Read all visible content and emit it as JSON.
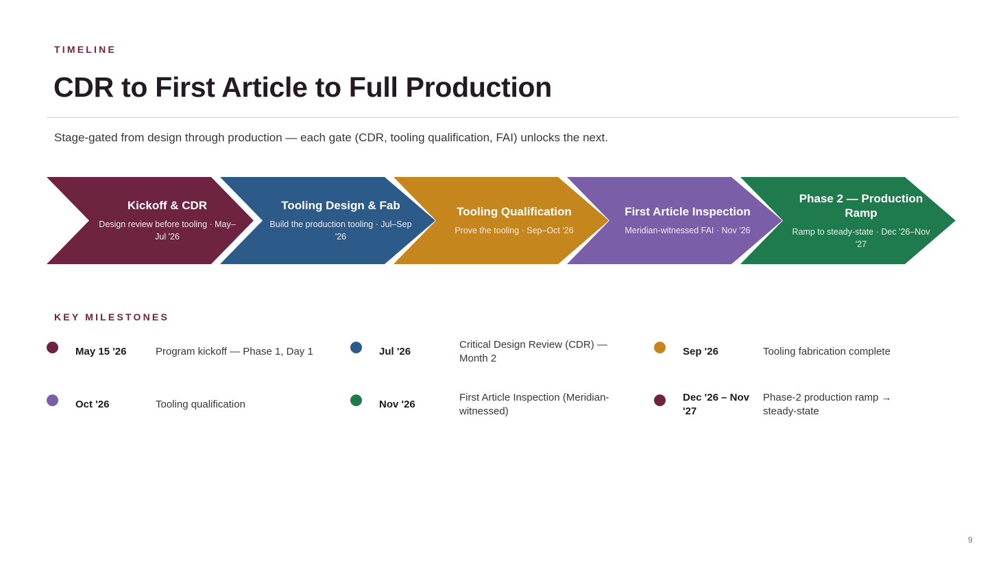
{
  "eyebrow": "TIMELINE",
  "title": "CDR to First Article to Full Production",
  "subtitle": "Stage-gated from design through production — each gate (CDR, tooling qualification, FAI) unlocks the next.",
  "phases": [
    {
      "name": "Kickoff & CDR",
      "desc": "Design review before tooling · May–Jul '26",
      "color": "#6e2440"
    },
    {
      "name": "Tooling Design & Fab",
      "desc": "Build the production tooling · Jul–Sep '26",
      "color": "#2c5b8a"
    },
    {
      "name": "Tooling Qualification",
      "desc": "Prove the tooling · Sep–Oct '26",
      "color": "#c5861d"
    },
    {
      "name": "First Article Inspection",
      "desc": "Meridian-witnessed FAI · Nov '26",
      "color": "#7b5ea8"
    },
    {
      "name": "Phase 2 — Production Ramp",
      "desc": "Ramp to steady-state · Dec '26–Nov '27",
      "color": "#1f7a4d"
    }
  ],
  "milestones_title": "KEY MILESTONES",
  "milestones": [
    {
      "date": "May 15 '26",
      "text": "Program kickoff — Phase 1, Day 1",
      "color": "#6e2440"
    },
    {
      "date": "Jul '26",
      "text": "Critical Design Review (CDR) — Month 2",
      "color": "#2c5b8a"
    },
    {
      "date": "Sep '26",
      "text": "Tooling fabrication complete",
      "color": "#c5861d"
    },
    {
      "date": "Oct '26",
      "text": "Tooling qualification",
      "color": "#7b5ea8"
    },
    {
      "date": "Nov '26",
      "text": "First Article Inspection (Meridian-witnessed)",
      "color": "#1f7a4d"
    },
    {
      "date": "Dec '26 – Nov '27",
      "text": "Phase-2 production ramp → steady-state",
      "color": "#6e2440"
    }
  ],
  "page_number": "9"
}
